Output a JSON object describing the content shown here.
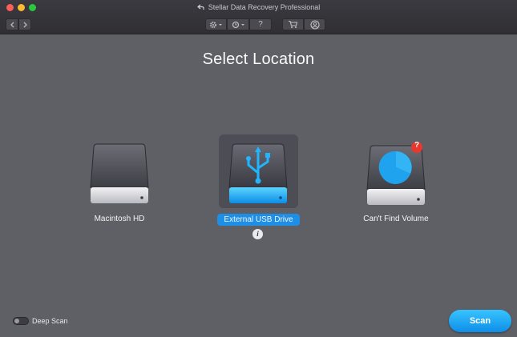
{
  "window": {
    "title": "Stellar Data Recovery Professional"
  },
  "toolbar": {
    "icons": [
      "back-arrow-icon",
      "forward-arrow-icon",
      "gear-icon",
      "history-icon",
      "help-icon",
      "cart-icon",
      "user-icon"
    ],
    "help_label": "?"
  },
  "page": {
    "title": "Select Location"
  },
  "drives": [
    {
      "label": "Macintosh HD",
      "icon": "hard-drive-icon",
      "selected": false
    },
    {
      "label": "External USB Drive",
      "icon": "usb-drive-icon",
      "selected": true
    },
    {
      "label": "Can't Find Volume",
      "icon": "pie-drive-icon",
      "selected": false,
      "badge": "?"
    }
  ],
  "info_badge": "i",
  "options": {
    "deep_scan_label": "Deep Scan",
    "deep_scan_on": false
  },
  "actions": {
    "scan_label": "Scan"
  },
  "colors": {
    "background": "#5f5f66",
    "accent": "#1d8fe6",
    "badge_red": "#e8382e"
  }
}
